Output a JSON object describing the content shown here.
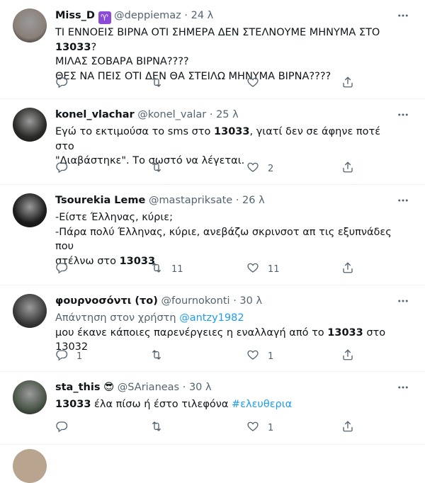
{
  "tweets": [
    {
      "name": "Miss_D",
      "handle": "@deppiemaz",
      "time": "24 λ",
      "avatar_color": "#8a7e78",
      "lines": [
        [
          {
            "t": "ΤΙ ΕΝΝΟΕΙΣ ΒΙΡΝΑ ΟΤΙ ΣΗΜΕΡΑ ΔΕΝ ΣΤΕΛΝΟΥΜΕ ΜΗΝΥΜΑ ΣΤΟ "
          },
          {
            "t": "13033",
            "b": true
          },
          {
            "t": "?"
          }
        ],
        [
          {
            "t": "ΜΙΛΑΣ ΣΟΒΑΡΑ ΒΙΡΝΑ????"
          }
        ],
        [
          {
            "t": "ΘΕΣ ΝΑ ΠΕΙΣ ΟΤΙ ΔΕΝ ΘΑ ΣΤΕΙΛΩ ΜΗΝΥΜΑ ΒΙΡΝΑ????"
          }
        ]
      ],
      "replies": "",
      "retweets": "",
      "likes": ""
    },
    {
      "name": "konel_vlachar",
      "handle": "@konel_valar",
      "time": "25 λ",
      "avatar_color": "#2a2a28",
      "lines": [
        [
          {
            "t": "Εγώ το εκτιμούσα το sms στο "
          },
          {
            "t": "13033",
            "b": true
          },
          {
            "t": ", γιατί δεν σε άφηνε ποτέ στο"
          }
        ],
        [
          {
            "t": "\"Διαβάστηκε\". Το σωστό να λέγεται."
          }
        ]
      ],
      "replies": "",
      "retweets": "",
      "likes": "2"
    },
    {
      "name": "Tsourekia Leme",
      "handle": "@mastapriksate",
      "time": "26 λ",
      "avatar_color": "#1c1c1c",
      "lines": [
        [
          {
            "t": "-Είστε Έλληνας, κύριε;"
          }
        ],
        [
          {
            "t": "-Πάρα πολύ Έλληνας, κύριε, ανεβάζω σκρινσοτ απ τις εξυπνάδες που"
          }
        ],
        [
          {
            "t": "στέλνω στο "
          },
          {
            "t": "13033",
            "b": true
          }
        ]
      ],
      "replies": "",
      "retweets": "11",
      "likes": "11"
    },
    {
      "name": "φουρνοσόντι (το)",
      "handle": "@fournokonti",
      "time": "30 λ",
      "avatar_color": "#3a3a3a",
      "reply_label": "Απάντηση στον χρήστη",
      "reply_handle": "@antzy1982",
      "lines": [
        [
          {
            "t": "μου έκανε κάποιες παρενέργειες η εναλλαγή από το "
          },
          {
            "t": "13033",
            "b": true
          },
          {
            "t": " στο 13032"
          }
        ]
      ],
      "replies": "1",
      "retweets": "",
      "likes": "1"
    },
    {
      "name": "sta_this",
      "emoji": "😎",
      "handle": "@SArianeas",
      "time": "30 λ",
      "avatar_color": "#4a5548",
      "lines": [
        [
          {
            "t": "13033",
            "b": true
          },
          {
            "t": " έλα πίσω ή έστο τιλεφόνα "
          },
          {
            "t": "#ελευθερια",
            "link": true
          }
        ]
      ],
      "replies": "",
      "retweets": "",
      "likes": "1"
    }
  ],
  "icons": {
    "reply": "reply-icon",
    "retweet": "retweet-icon",
    "like": "heart-icon",
    "share": "share-icon",
    "more": "more-icon"
  },
  "colors": {
    "text": "#0f1419",
    "secondary": "#536471",
    "link": "#1d9bf0",
    "zodiac_badge": "#8b4bd8",
    "divider": "#eff3f4"
  }
}
